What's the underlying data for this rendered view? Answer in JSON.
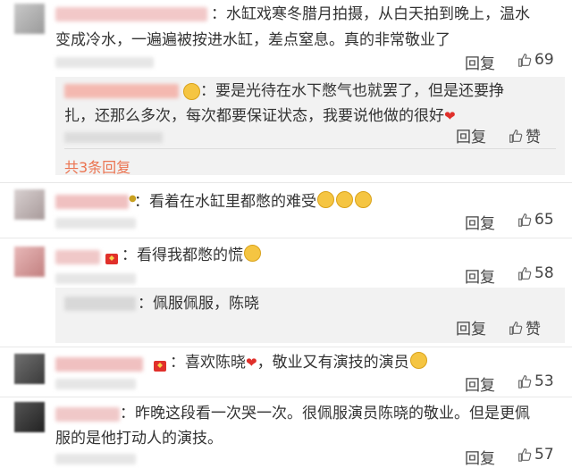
{
  "comments": [
    {
      "text_line1": "：水缸戏寒冬腊月拍摄，从白天拍到晚上，温水",
      "text_line2": "变成冷水，一遍遍被按进水缸，差点窒息。真的非常敬业了",
      "reply_label": "回复",
      "like_count": "69"
    },
    {
      "text_line1": "：要是光待在水下憋气也就罢了，但是还要挣",
      "text_line2": "扎，还那么多次，每次都要保证状态，我要说他做的很好",
      "reply_label": "回复",
      "like_label": "赞",
      "more_replies": "共3条回复"
    },
    {
      "text": "：看着在水缸里都憋的难受",
      "reply_label": "回复",
      "like_count": "65"
    },
    {
      "text": "：看得我都憋的慌",
      "reply_label": "回复",
      "like_count": "58"
    },
    {
      "text": "：佩服佩服，陈晓",
      "reply_label": "回复",
      "like_label": "赞"
    },
    {
      "text_before": "：喜欢陈晓",
      "text_after": "，敬业又有演技的演员",
      "reply_label": "回复",
      "like_count": "53"
    },
    {
      "text_line1": "：昨晚这段看一次哭一次。很佩服演员陈晓的敬业。但是更佩",
      "text_line2": "服的是他打动人的演技。",
      "reply_label": "回复",
      "like_count": "57"
    }
  ],
  "colors": {
    "link_orange": "#eb7350",
    "heart_red": "#e0302b",
    "subbox_bg": "#f2f2f2"
  }
}
